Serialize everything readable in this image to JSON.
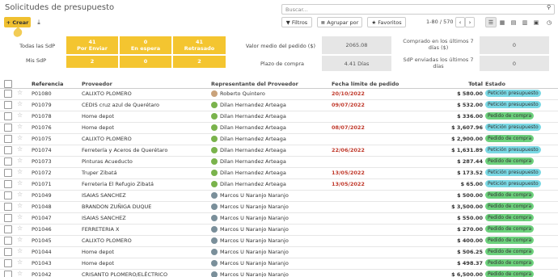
{
  "header": {
    "title": "Solicitudes de presupuesto",
    "search_placeholder": "Buscar...",
    "crear_label": "+ Crear",
    "filtros_label": "▼ Filtros",
    "agrupar_label": "≣ Agrupar por",
    "favoritos_label": "★ Favoritos",
    "pager_text": "1-80 / 570"
  },
  "dashboard": {
    "todas_label": "Todas las SdP",
    "mis_label": "Mis SdP",
    "cards": [
      {
        "value": "41",
        "label": "Por Enviar",
        "mine": "2"
      },
      {
        "value": "0",
        "label": "En espera",
        "mine": "0"
      },
      {
        "value": "41",
        "label": "Retrasado",
        "mine": "2"
      }
    ],
    "valor_medio_label": "Valor medio del pedido ($)",
    "valor_medio_value": "2065.08",
    "plazo_label": "Plazo de compra",
    "plazo_value": "4.41  Días",
    "comprado_label": "Comprado en los últimos 7 días ($)",
    "comprado_value": "0",
    "enviadas_label": "SdP enviadas los últimos 7 días",
    "enviadas_value": "0"
  },
  "table": {
    "columns": [
      "Referencia",
      "Proveedor",
      "Representante del Proveedor",
      "Fecha límite de pedido",
      "Total",
      "Estado"
    ],
    "rows": [
      {
        "ref": "P01080",
        "prov": "CALIXTO PLOMERO",
        "rep": "Roberto Quintero",
        "fecha": "20/10/2022",
        "total": "$ 580.00",
        "estado": "Petición presupuesto"
      },
      {
        "ref": "P01079",
        "prov": "CEDIS cruz azul de Querétaro",
        "rep": "Dilan Hernandez Arteaga",
        "fecha": "09/07/2022",
        "total": "$ 532.00",
        "estado": "Petición presupuesto"
      },
      {
        "ref": "P01078",
        "prov": "Home depot",
        "rep": "Dilan Hernandez Arteaga",
        "fecha": "",
        "total": "$ 336.00",
        "estado": "Pedido de compra"
      },
      {
        "ref": "P01076",
        "prov": "Home depot",
        "rep": "Dilan Hernandez Arteaga",
        "fecha": "08/07/2022",
        "total": "$ 3,607.96",
        "estado": "Petición presupuesto"
      },
      {
        "ref": "P01075",
        "prov": "CALIXTO PLOMERO",
        "rep": "Dilan Hernandez Arteaga",
        "fecha": "",
        "total": "$ 2,900.00",
        "estado": "Pedido de compra"
      },
      {
        "ref": "P01074",
        "prov": "Ferretería y Aceros de Querétaro",
        "rep": "Dilan Hernandez Arteaga",
        "fecha": "22/06/2022",
        "total": "$ 1,631.89",
        "estado": "Petición presupuesto"
      },
      {
        "ref": "P01073",
        "prov": "Pinturas Acueducto",
        "rep": "Dilan Hernandez Arteaga",
        "fecha": "",
        "total": "$ 287.44",
        "estado": "Pedido de compra"
      },
      {
        "ref": "P01072",
        "prov": "Truper Zibatá",
        "rep": "Dilan Hernandez Arteaga",
        "fecha": "13/05/2022",
        "total": "$ 173.52",
        "estado": "Petición presupuesto"
      },
      {
        "ref": "P01071",
        "prov": "Ferreteria El Refugio Zibatá",
        "rep": "Dilan Hernandez Arteaga",
        "fecha": "13/05/2022",
        "total": "$ 65.00",
        "estado": "Petición presupuesto"
      },
      {
        "ref": "P01049",
        "prov": "ISAIAS SANCHEZ",
        "rep": "Marcos U Naranjo Naranjo",
        "fecha": "",
        "total": "$ 500.00",
        "estado": "Pedido de compra"
      },
      {
        "ref": "P01048",
        "prov": "BRANDON ZUÑIGA DUQUE",
        "rep": "Marcos U Naranjo Naranjo",
        "fecha": "",
        "total": "$ 3,500.00",
        "estado": "Pedido de compra"
      },
      {
        "ref": "P01047",
        "prov": "ISAIAS SANCHEZ",
        "rep": "Marcos U Naranjo Naranjo",
        "fecha": "",
        "total": "$ 550.00",
        "estado": "Pedido de compra"
      },
      {
        "ref": "P01046",
        "prov": "FERRETERIA X",
        "rep": "Marcos U Naranjo Naranjo",
        "fecha": "",
        "total": "$ 270.00",
        "estado": "Pedido de compra"
      },
      {
        "ref": "P01045",
        "prov": "CALIXTO PLOMERO",
        "rep": "Marcos U Naranjo Naranjo",
        "fecha": "",
        "total": "$ 400.00",
        "estado": "Pedido de compra"
      },
      {
        "ref": "P01044",
        "prov": "Home depot",
        "rep": "Marcos U Naranjo Naranjo",
        "fecha": "",
        "total": "$ 506.25",
        "estado": "Pedido de compra"
      },
      {
        "ref": "P01043",
        "prov": "Home depot",
        "rep": "Marcos U Naranjo Naranjo",
        "fecha": "",
        "total": "$ 498.37",
        "estado": "Pedido de compra"
      },
      {
        "ref": "P01042",
        "prov": "CRISANTO PLOMERO/ELÉCTRICO",
        "rep": "Marcos U Naranjo Naranjo",
        "fecha": "",
        "total": "$ 6,500.00",
        "estado": "Pedido de compra"
      }
    ]
  },
  "colors": {
    "accent": "#f4c530",
    "deadline": "#c0392b",
    "badge_peticion": "#7ad8e4",
    "badge_pedido": "#6cd07c"
  }
}
